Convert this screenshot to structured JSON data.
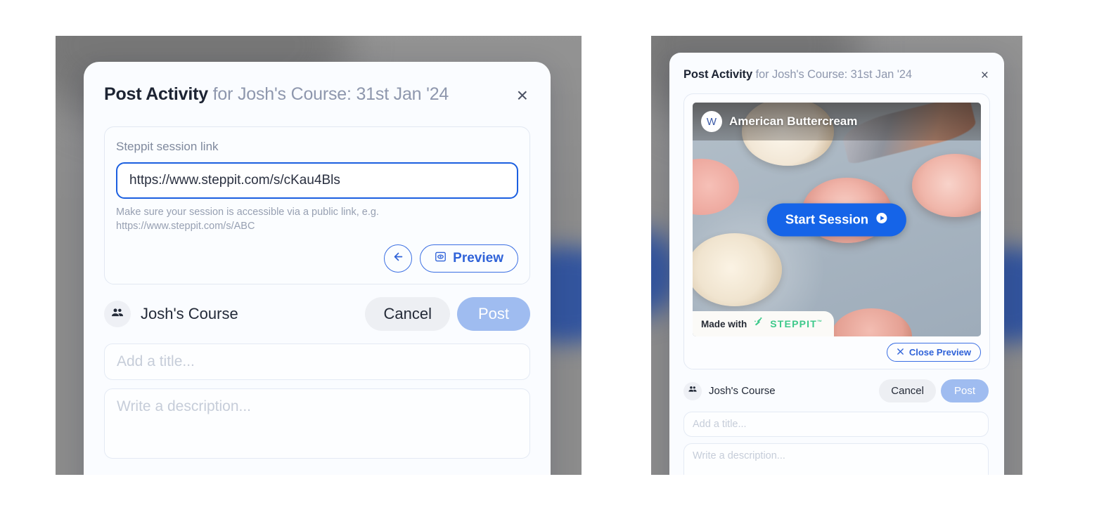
{
  "left_panel": {
    "modal": {
      "title_strong": "Post Activity",
      "title_rest": " for Josh's Course: 31st Jan '24",
      "close_label": "×",
      "link_section": {
        "field_label": "Steppit session link",
        "input_value": "https://www.steppit.com/s/cKau4Bls",
        "input_placeholder": "https://www.steppit.com/s/ABC",
        "help_text": "Make sure your session is accessible via a public link, e.g. https://www.steppit.com/s/ABC",
        "back_icon": "arrow-left-icon",
        "preview_label": "Preview",
        "preview_icon": "eye-preview-icon"
      },
      "course_row": {
        "avatar_icon": "people-group-icon",
        "course_name": "Josh's Course",
        "cancel_label": "Cancel",
        "post_label": "Post"
      },
      "title_placeholder": "Add a title...",
      "description_placeholder": "Write a description...",
      "title_value": "",
      "description_value": ""
    }
  },
  "right_panel": {
    "modal": {
      "title_strong": "Post Activity",
      "title_rest": " for Josh's Course: 31st Jan '24",
      "close_label": "×",
      "preview_card": {
        "media": {
          "avatar_initial": "W",
          "media_title": "American Buttercream",
          "start_session_label": "Start Session",
          "start_session_icon": "play-circle-icon",
          "made_with_label": "Made with",
          "brand_name": "STEPPIT",
          "brand_tm": "™"
        },
        "close_preview_label": "Close Preview",
        "close_preview_icon": "close-x-icon"
      },
      "course_row": {
        "avatar_icon": "people-group-icon",
        "course_name": "Josh's Course",
        "cancel_label": "Cancel",
        "post_label": "Post"
      },
      "title_placeholder": "Add a title...",
      "description_placeholder": "Write a description...",
      "title_value": "",
      "description_value": ""
    }
  },
  "colors": {
    "accent_blue": "#1b5fe0",
    "start_session_blue": "#1564e8",
    "post_button_blue": "#9fbcf0",
    "brand_green": "#3ec98b",
    "title_dark": "#1d2433",
    "title_muted": "#8e97ad",
    "backdrop_grey": "#8c8c8c",
    "backdrop_blue_blob": "#33559e"
  }
}
